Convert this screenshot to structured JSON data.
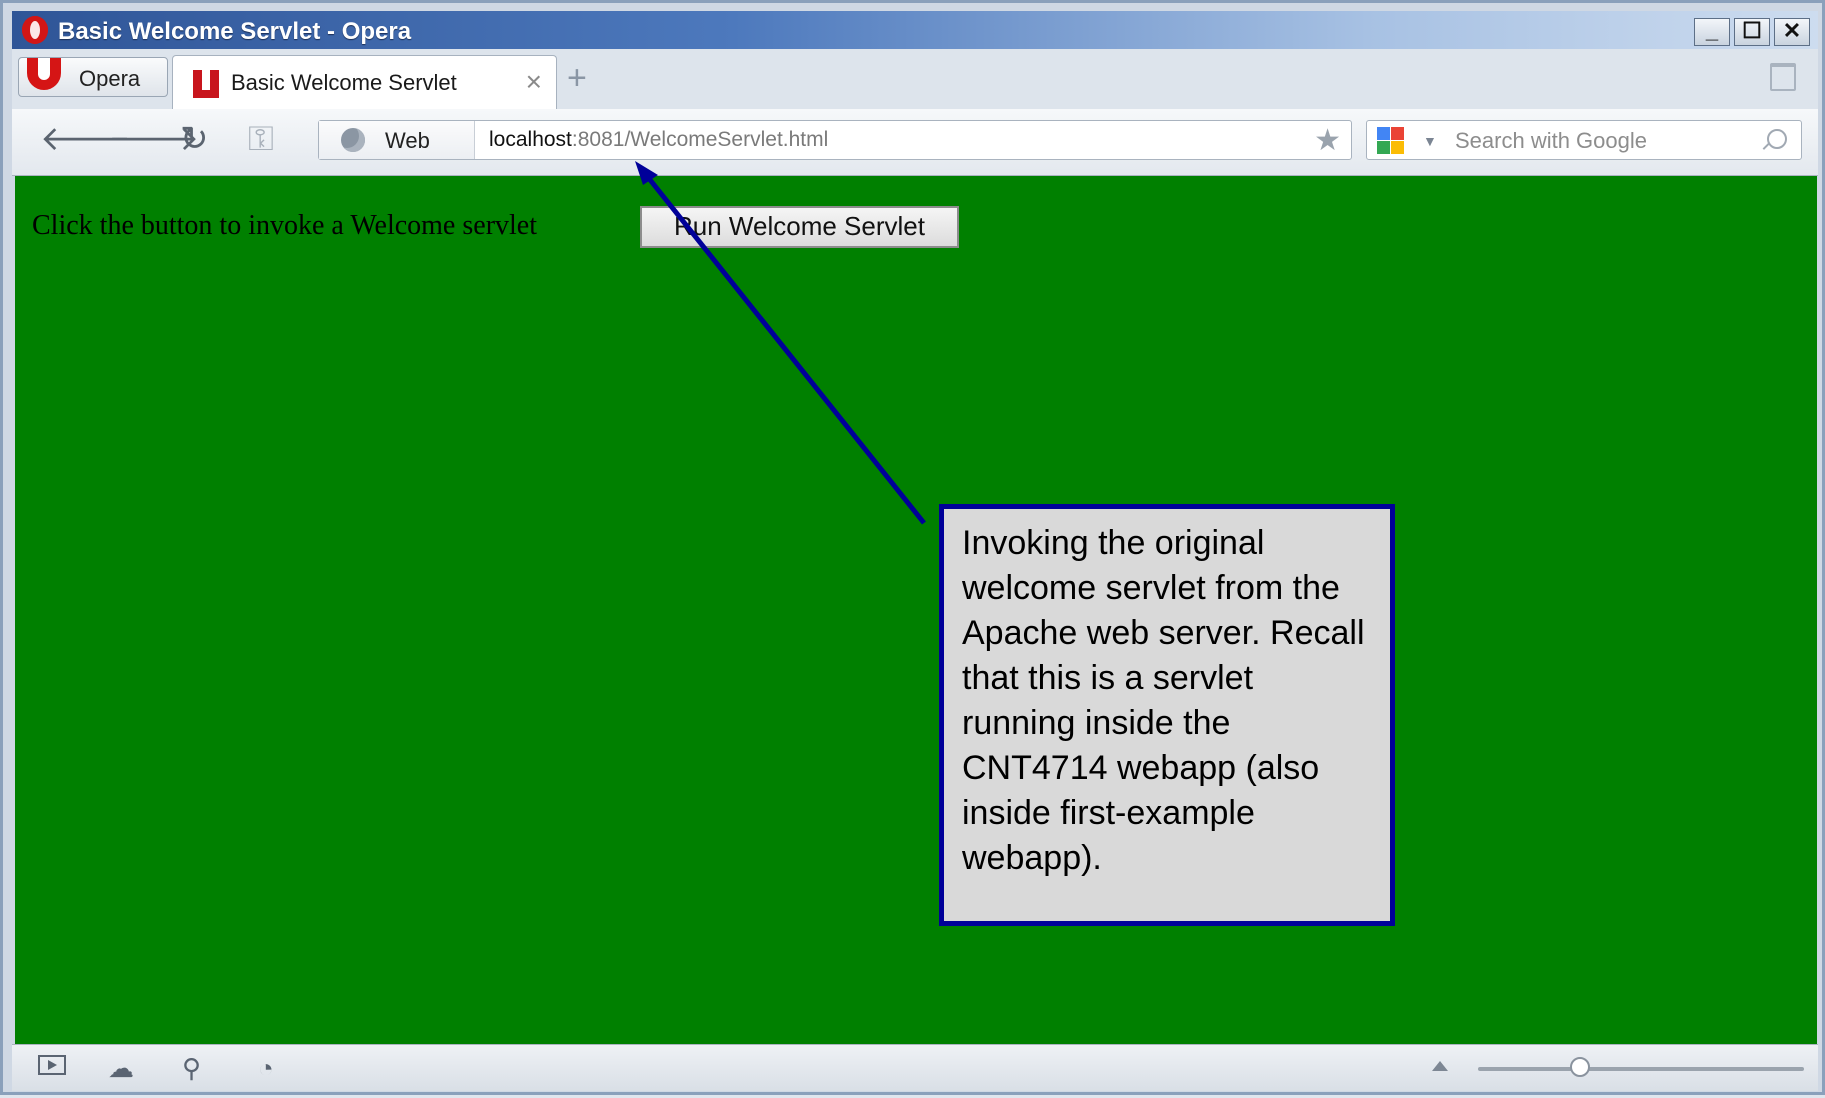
{
  "window": {
    "title": "Basic Welcome Servlet - Opera",
    "controls": {
      "minimize": "_",
      "maximize": "☐",
      "close": "✕"
    }
  },
  "tabbar": {
    "menu_label": "Opera",
    "active_tab": {
      "title": "Basic Welcome Servlet",
      "close": "×"
    },
    "new_tab": "+"
  },
  "toolbar": {
    "back": "🡐",
    "forward": "🡒",
    "reload": "↻",
    "key": "⚿",
    "web_label": "Web",
    "url_host": "localhost",
    "url_rest": ":8081/WelcomeServlet.html",
    "bookmark": "★",
    "search_placeholder": "Search with Google"
  },
  "page": {
    "background": "#008000",
    "prompt": "Click the button to invoke a Welcome servlet",
    "button_label": "Run Welcome Servlet"
  },
  "callout": {
    "text": "Invoking the original welcome servlet from the Apache web server. Recall that this is a servlet running inside the CNT4714 webapp (also inside first-example webapp).",
    "border_color": "#000099",
    "arrow_color": "#000099"
  },
  "statusbar": {
    "icons": [
      "panel-icon",
      "cloud-icon",
      "share-icon",
      "speed-icon"
    ]
  }
}
